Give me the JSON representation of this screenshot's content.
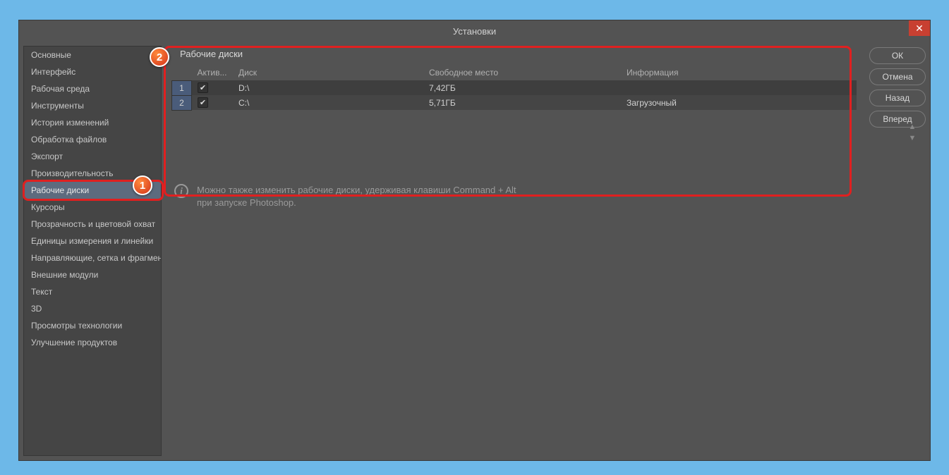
{
  "title": "Установки",
  "sidebar": {
    "items": [
      "Основные",
      "Интерфейс",
      "Рабочая среда",
      "Инструменты",
      "История изменений",
      "Обработка файлов",
      "Экспорт",
      "Производительность",
      "Рабочие диски",
      "Курсоры",
      "Прозрачность и цветовой охват",
      "Единицы измерения и линейки",
      "Направляющие, сетка и фрагменты",
      "Внешние модули",
      "Текст",
      "3D",
      "Просмотры технологии",
      "Улучшение продуктов"
    ],
    "selectedIndex": 8
  },
  "panel": {
    "title": "Рабочие диски",
    "columns": {
      "active": "Актив...",
      "disk": "Диск",
      "free": "Свободное место",
      "info": "Информация"
    },
    "rows": [
      {
        "n": "1",
        "active": true,
        "disk": "D:\\",
        "free": "7,42ГБ",
        "info": ""
      },
      {
        "n": "2",
        "active": true,
        "disk": "C:\\",
        "free": "5,71ГБ",
        "info": "Загрузочный"
      }
    ]
  },
  "hint": {
    "line1": "Можно также изменить рабочие диски, удерживая клавиши Command + Alt",
    "line2": "при запуске Photoshop."
  },
  "buttons": {
    "ok": "ОК",
    "cancel": "Отмена",
    "prev": "Назад",
    "next": "Вперед"
  },
  "callouts": {
    "b1": "1",
    "b2": "2"
  }
}
